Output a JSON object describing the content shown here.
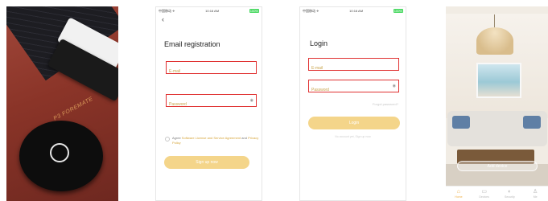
{
  "product": {
    "brand_text": "P3 FOREMATE"
  },
  "status_bar": {
    "carrier": "中国移动 ✈",
    "time": "10:16 AM",
    "battery": "100%"
  },
  "registration": {
    "title": "Email registration",
    "email_placeholder": "E-mail",
    "password_placeholder": "Password",
    "agree_prefix": "Agree ",
    "agree_link1": "Software License and Service Agreement",
    "agree_and": " and ",
    "agree_link2": "Privacy Policy",
    "signup_label": "Sign up now"
  },
  "login": {
    "title": "Login",
    "email_placeholder": "E-mail",
    "password_placeholder": "Password",
    "forgot_label": "Forgot password?",
    "login_label": "Login",
    "no_account_label": "No account yet, Sign up now"
  },
  "home": {
    "add_device_label": "Add device",
    "tabs": [
      {
        "label": "Home",
        "icon": "home-icon"
      },
      {
        "label": "Devices",
        "icon": "devices-icon"
      },
      {
        "label": "Security",
        "icon": "security-icon"
      },
      {
        "label": "Me",
        "icon": "me-icon"
      }
    ],
    "active_color": "#f0b24a"
  },
  "colors": {
    "accent": "#f4d58a",
    "highlight_box": "#e03131",
    "link": "#d6a438"
  }
}
